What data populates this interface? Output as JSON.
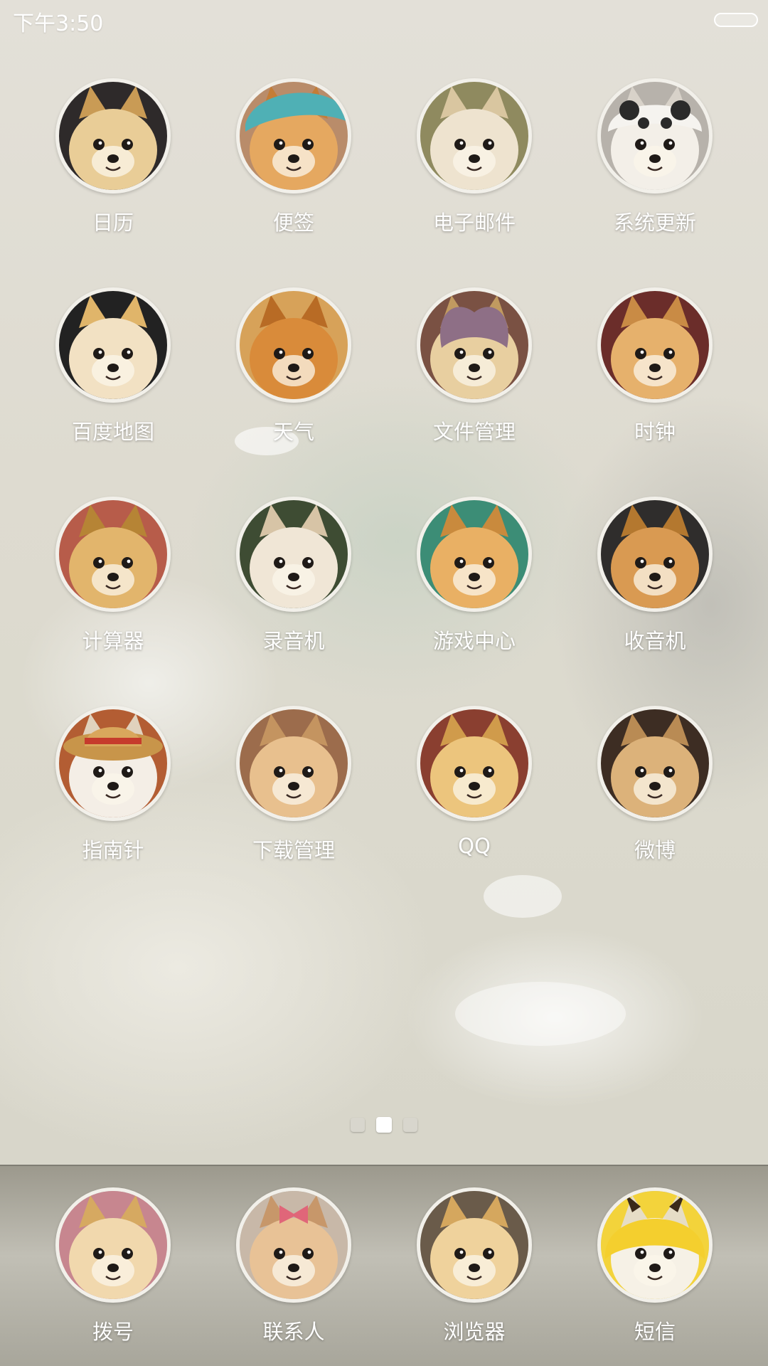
{
  "status_bar": {
    "time": "下午3:50"
  },
  "home": {
    "apps": [
      {
        "id": "calendar",
        "label": "日历",
        "fur": "#e9cd97",
        "ear": "#c99b55",
        "bg": "#2e2a2a",
        "accessory": "none"
      },
      {
        "id": "notes",
        "label": "便签",
        "fur": "#e5a860",
        "ear": "#c47d36",
        "bg": "#b98c6a",
        "accessory": "blue-hat"
      },
      {
        "id": "email",
        "label": "电子邮件",
        "fur": "#eee3cf",
        "ear": "#d9c6a0",
        "bg": "#8f8a5f",
        "accessory": "none"
      },
      {
        "id": "system-update",
        "label": "系统更新",
        "fur": "#f3efe8",
        "ear": "#d8d2c9",
        "bg": "#b7b2ab",
        "accessory": "panda-hat"
      },
      {
        "id": "baidu-map",
        "label": "百度地图",
        "fur": "#f2e1c3",
        "ear": "#e0b56a",
        "bg": "#222222",
        "accessory": "none"
      },
      {
        "id": "weather",
        "label": "天气",
        "fur": "#d98b3a",
        "ear": "#b86b25",
        "bg": "#d7a259",
        "accessory": "none"
      },
      {
        "id": "file-manager",
        "label": "文件管理",
        "fur": "#e8cfa0",
        "ear": "#c19a60",
        "bg": "#7a5143",
        "accessory": "bunny-hat"
      },
      {
        "id": "clock",
        "label": "时钟",
        "fur": "#e6b16c",
        "ear": "#c98b45",
        "bg": "#6b2d2a",
        "accessory": "none"
      },
      {
        "id": "calculator",
        "label": "计算器",
        "fur": "#e2b56c",
        "ear": "#b68435",
        "bg": "#b75c4a",
        "accessory": "none"
      },
      {
        "id": "recorder",
        "label": "录音机",
        "fur": "#f0e6d6",
        "ear": "#d7c4a6",
        "bg": "#3e4c33",
        "accessory": "none"
      },
      {
        "id": "game-center",
        "label": "游戏中心",
        "fur": "#e9b064",
        "ear": "#c98a3d",
        "bg": "#3c8d76",
        "accessory": "none"
      },
      {
        "id": "radio",
        "label": "收音机",
        "fur": "#d99a52",
        "ear": "#b4782f",
        "bg": "#2f2d2c",
        "accessory": "none"
      },
      {
        "id": "compass",
        "label": "指南针",
        "fur": "#f4eee6",
        "ear": "#e0d2bd",
        "bg": "#b35d33",
        "accessory": "straw-hat"
      },
      {
        "id": "download-manager",
        "label": "下载管理",
        "fur": "#e8c08e",
        "ear": "#c49460",
        "bg": "#9c6c4c",
        "accessory": "none"
      },
      {
        "id": "qq",
        "label": "QQ",
        "fur": "#ecc57d",
        "ear": "#d09b4b",
        "bg": "#8a3f30",
        "accessory": "none"
      },
      {
        "id": "weibo",
        "label": "微博",
        "fur": "#dcb27a",
        "ear": "#b98b54",
        "bg": "#3d2d23",
        "accessory": "none"
      }
    ]
  },
  "page_indicator": {
    "count": 3,
    "active_index": 1
  },
  "dock": {
    "apps": [
      {
        "id": "dialer",
        "label": "拨号",
        "fur": "#f1d8ad",
        "ear": "#d6a961",
        "bg": "#c7868f",
        "accessory": "none"
      },
      {
        "id": "contacts",
        "label": "联系人",
        "fur": "#e8c296",
        "ear": "#c7976a",
        "bg": "#c8b8a8",
        "accessory": "bow"
      },
      {
        "id": "browser",
        "label": "浏览器",
        "fur": "#efd29c",
        "ear": "#d5a75e",
        "bg": "#6a5b4a",
        "accessory": "none"
      },
      {
        "id": "sms",
        "label": "短信",
        "fur": "#f6f1e6",
        "ear": "#e6ddc6",
        "bg": "#f3d33b",
        "accessory": "yellow-hat"
      }
    ]
  }
}
